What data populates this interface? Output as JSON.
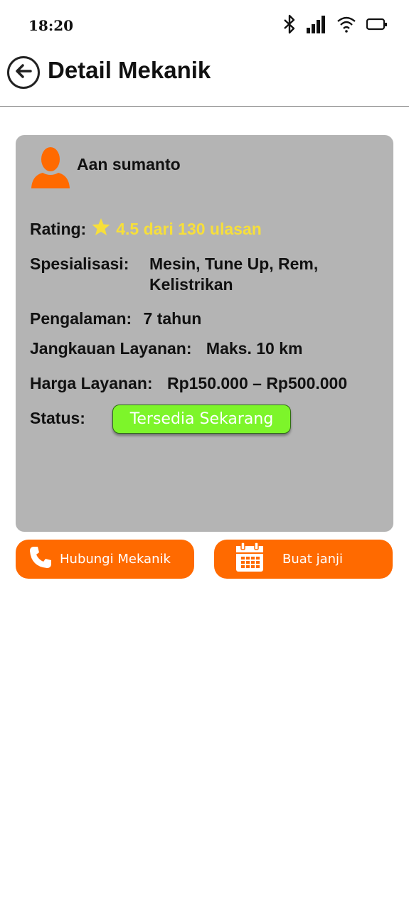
{
  "status_bar": {
    "time": "18:20",
    "icons": [
      "bluetooth-icon",
      "signal-icon",
      "wifi-icon",
      "battery-icon"
    ]
  },
  "header": {
    "title": "Detail Mekanik",
    "back_icon": "arrow-left-circle-icon"
  },
  "mechanic": {
    "name": "Aan sumanto",
    "avatar_icon": "person-silhouette-icon",
    "rating_label": "Rating:",
    "rating_text": "4.5 dari 130 ulasan",
    "specialization_label": "Spesialisasi:",
    "specialization_line1": "Mesin, Tune Up, Rem,",
    "specialization_line2": "Kelistrikan",
    "experience_label": "Pengalaman:",
    "experience_value": "7 tahun",
    "range_label": "Jangkauan Layanan:",
    "range_value": "Maks. 10 km",
    "price_label": "Harga Layanan:",
    "price_value": "Rp150.000 – Rp500.000",
    "status_label": "Status:",
    "status_value": "Tersedia Sekarang"
  },
  "actions": {
    "call_label": "Hubungi Mekanik",
    "appointment_label": "Buat janji"
  },
  "colors": {
    "accent": "#ff6a00",
    "card_bg": "#b4b4b4",
    "rating_text": "#f7df3a",
    "status_badge": "#7df52a"
  }
}
